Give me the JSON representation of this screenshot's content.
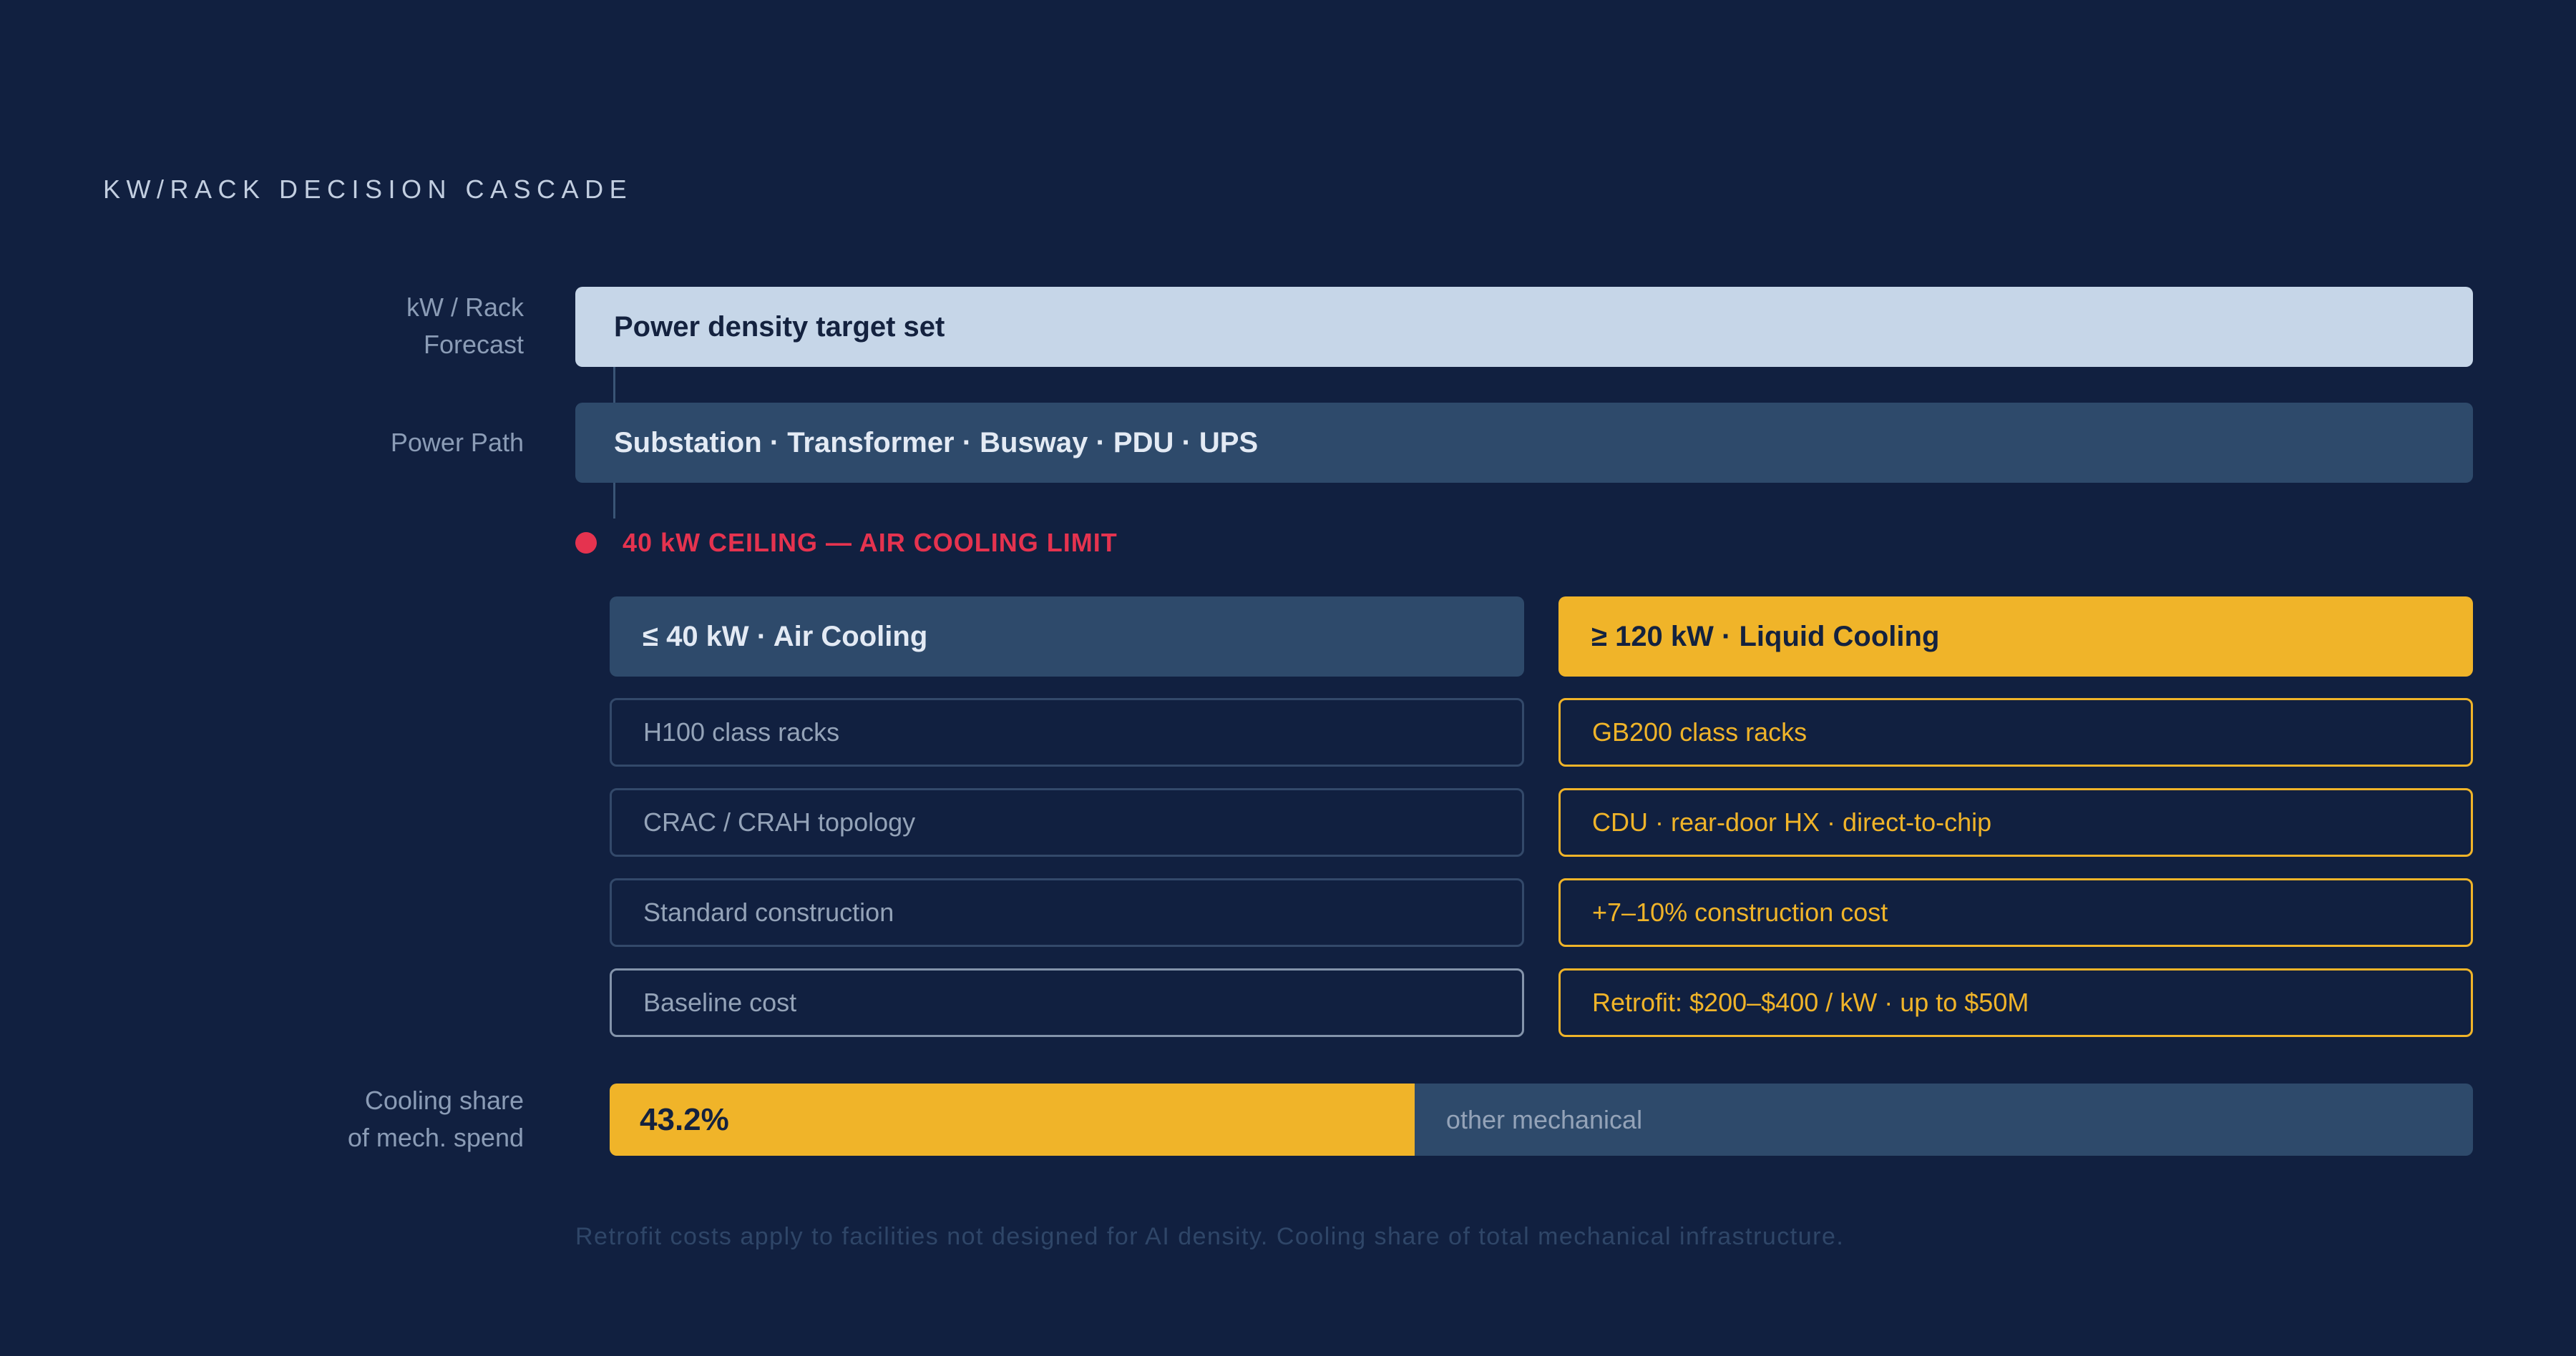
{
  "title": "KW/RACK DECISION CASCADE",
  "rows": {
    "forecast_label": [
      "kW / Rack",
      "Forecast"
    ],
    "power_path_label": "Power Path",
    "cooling_share_label": [
      "Cooling share",
      "of mech. spend"
    ]
  },
  "target": "Power density target set",
  "power_path": "Substation · Transformer · Busway · PDU · UPS",
  "ceiling": "40 kW CEILING — AIR COOLING LIMIT",
  "branches": {
    "air": {
      "header": "≤ 40 kW · Air Cooling",
      "items": [
        "H100 class racks",
        "CRAC / CRAH topology",
        "Standard construction",
        "Baseline cost"
      ]
    },
    "liquid": {
      "header": "≥ 120 kW · Liquid Cooling",
      "items": [
        "GB200 class racks",
        "CDU · rear-door HX · direct-to-chip",
        "+7–10% construction cost",
        "Retrofit: $200–$400 / kW · up to $50M"
      ]
    }
  },
  "cooling_share": {
    "value": 43.2,
    "label": "43.2%",
    "other_label": "other mechanical"
  },
  "footnote": "Retrofit costs apply to facilities not designed for AI density. Cooling share of total mechanical infrastructure.",
  "colors": {
    "background": "#112040",
    "accent": "#f0b429",
    "alert": "#e5334f",
    "panel": "#2e4a6b",
    "light_panel": "#c6d6e8"
  }
}
